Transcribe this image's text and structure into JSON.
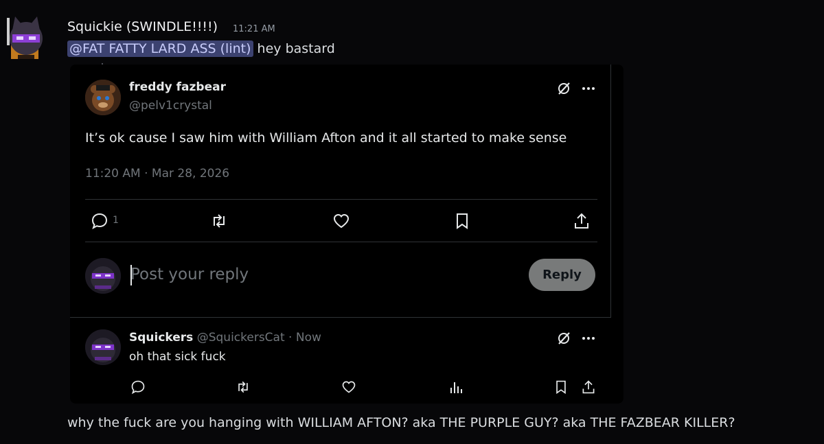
{
  "message": {
    "author": "Squickie (SWINDLE!!!!)",
    "timestamp": "11:21 AM",
    "mention": "@FAT FATTY LARD ASS (lint)",
    "text": " hey bastard",
    "followup": "why the fuck are you hanging with WILLIAM AFTON? aka THE PURPLE GUY? aka THE FAZBEAR KILLER?"
  },
  "tweet": {
    "display_name": "freddy fazbear",
    "handle": "@pelv1crystal",
    "text": "It’s ok cause I saw him with William Afton and it all started to make sense",
    "time": "11:20 AM · Mar 28, 2026",
    "reply_count": "1",
    "icons": {
      "grok": "grok-icon",
      "more": "more-icon",
      "reply": "reply-icon",
      "retweet": "retweet-icon",
      "like": "heart-icon",
      "bookmark": "bookmark-icon",
      "share": "share-icon"
    }
  },
  "composer": {
    "placeholder": "Post your reply",
    "button_label": "Reply"
  },
  "reply_tweet": {
    "display_name": "Squickers",
    "handle_and_time": " @SquickersCat · Now",
    "text": "oh that sick fuck",
    "icons": {
      "views": "views-icon"
    }
  },
  "colors": {
    "mention_bg": "#3c4270",
    "mention_text": "#c9cdfb",
    "reply_button_bg": "#787a7a",
    "muted_text": "#71767b"
  }
}
